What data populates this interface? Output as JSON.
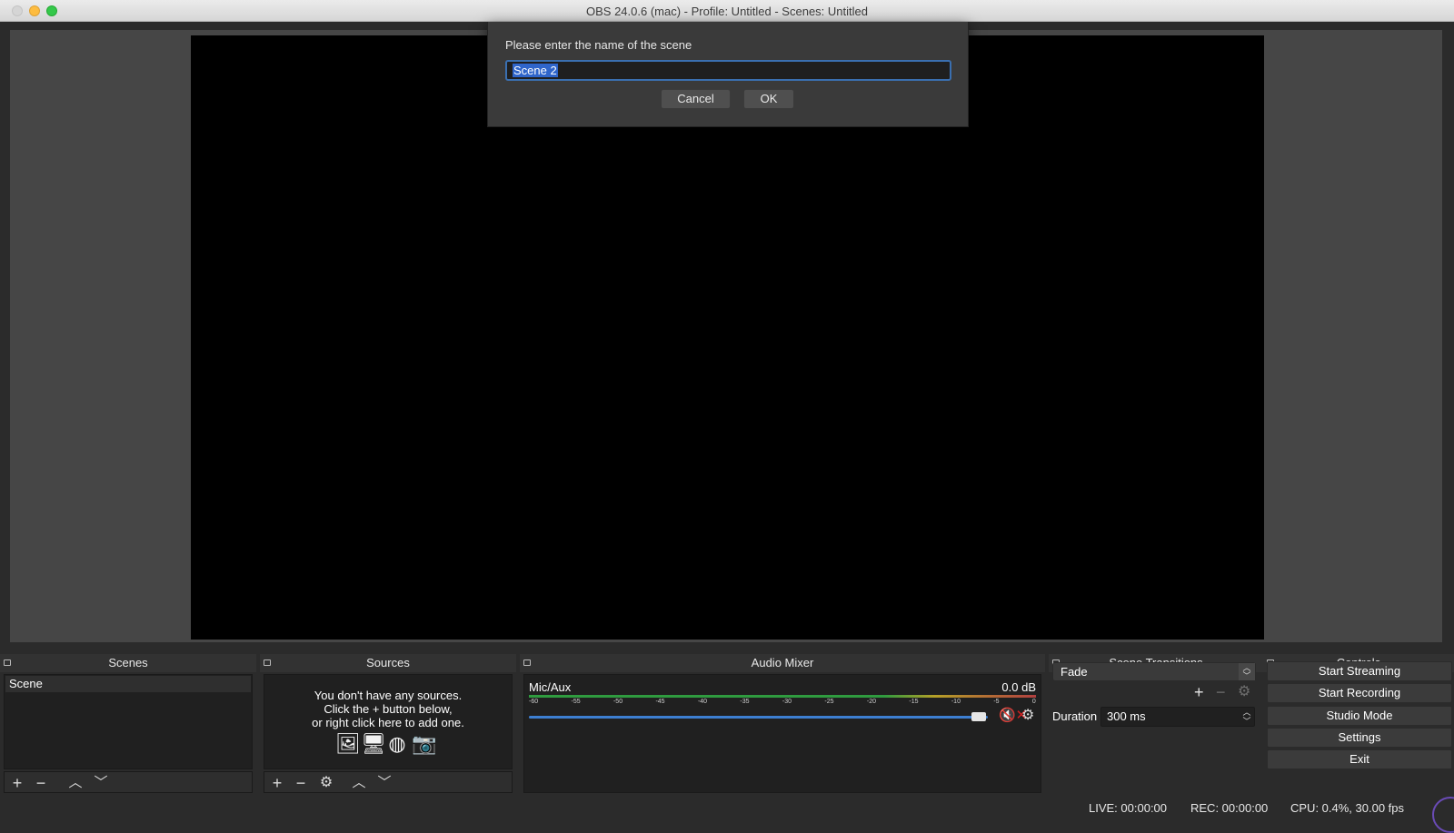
{
  "window": {
    "title": "OBS 24.0.6 (mac) - Profile: Untitled - Scenes: Untitled"
  },
  "dialog": {
    "prompt": "Please enter the name of the scene",
    "input_value": "Scene 2",
    "cancel_label": "Cancel",
    "ok_label": "OK"
  },
  "scenes": {
    "header": "Scenes",
    "items": [
      "Scene"
    ]
  },
  "sources": {
    "header": "Sources",
    "empty_line1": "You don't have any sources.",
    "empty_line2": "Click the + button below,",
    "empty_line3": "or right click here to add one.",
    "icons": [
      "image-icon",
      "display-icon",
      "globe-icon",
      "camera-icon"
    ]
  },
  "audio_mixer": {
    "header": "Audio Mixer",
    "channel_label": "Mic/Aux",
    "channel_db": "0.0 dB",
    "ticks": [
      "-60",
      "-55",
      "-50",
      "-45",
      "-40",
      "-35",
      "-30",
      "-25",
      "-20",
      "-15",
      "-10",
      "-5",
      "0"
    ],
    "volume_level": 0.98,
    "muted": true
  },
  "scene_transitions": {
    "header": "Scene Transitions",
    "selected": "Fade",
    "duration_label": "Duration",
    "duration_value": "300 ms"
  },
  "controls": {
    "header": "Controls",
    "start_streaming": "Start Streaming",
    "start_recording": "Start Recording",
    "studio_mode": "Studio Mode",
    "settings": "Settings",
    "exit": "Exit"
  },
  "status": {
    "live": "LIVE: 00:00:00",
    "rec": "REC: 00:00:00",
    "cpu": "CPU: 0.4%, 30.00 fps"
  },
  "colors": {
    "accent": "#3d7fd1",
    "selection": "#2f65ca",
    "muted": "#d31f1f",
    "background": "#2b2b2b"
  }
}
